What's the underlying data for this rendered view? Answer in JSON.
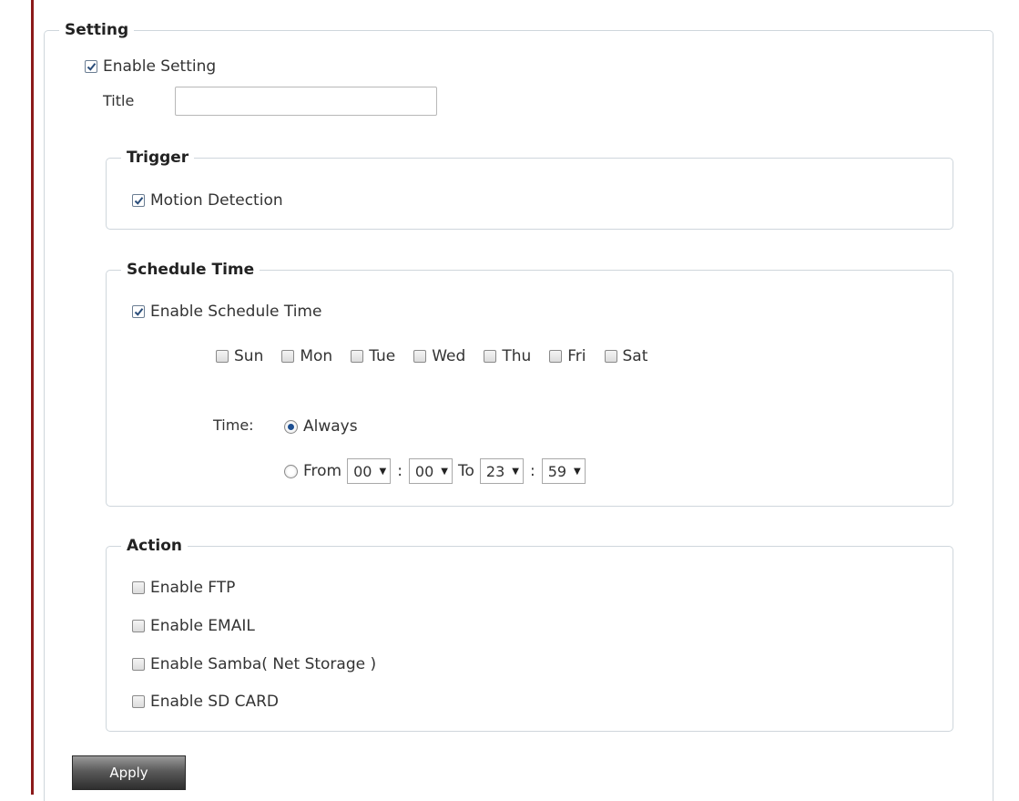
{
  "setting": {
    "legend": "Setting",
    "enable_label": "Enable Setting",
    "enable_checked": true,
    "title_label": "Title",
    "title_value": ""
  },
  "trigger": {
    "legend": "Trigger",
    "motion_label": "Motion Detection",
    "motion_checked": true
  },
  "schedule": {
    "legend": "Schedule Time",
    "enable_label": "Enable Schedule Time",
    "enable_checked": true,
    "days": [
      {
        "label": "Sun",
        "checked": false
      },
      {
        "label": "Mon",
        "checked": false
      },
      {
        "label": "Tue",
        "checked": false
      },
      {
        "label": "Wed",
        "checked": false
      },
      {
        "label": "Thu",
        "checked": false
      },
      {
        "label": "Fri",
        "checked": false
      },
      {
        "label": "Sat",
        "checked": false
      }
    ],
    "time_label": "Time:",
    "always_label": "Always",
    "always_selected": true,
    "from_label": "From",
    "from_hour": "00",
    "from_minute": "00",
    "to_label": "To",
    "to_hour": "23",
    "to_minute": "59",
    "colon": ":"
  },
  "action": {
    "legend": "Action",
    "ftp_label": "Enable FTP",
    "email_label": "Enable EMAIL",
    "samba_label": "Enable Samba( Net Storage )",
    "sd_label": "Enable SD CARD"
  },
  "apply_label": "Apply",
  "colors": {
    "accent_rule": "#8b1a1a",
    "group_border": "#cfd6dc",
    "radio_dot": "#1d4f91"
  }
}
